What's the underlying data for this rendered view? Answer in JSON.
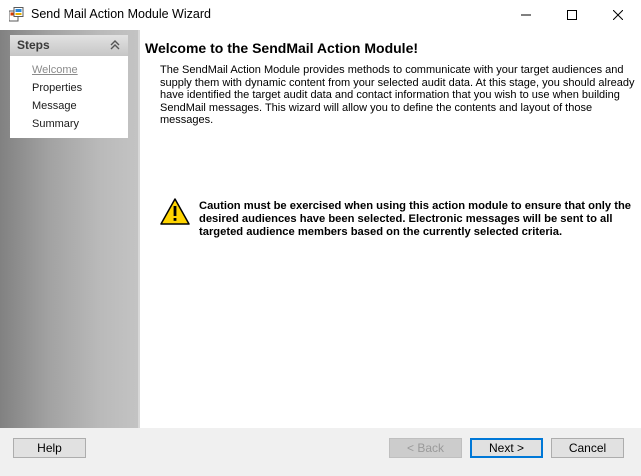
{
  "window": {
    "title": "Send Mail Action Module Wizard",
    "icon": "app-icon"
  },
  "sidebar": {
    "header": "Steps",
    "collapse_icon": "chevrons-up-icon",
    "items": [
      {
        "label": "Welcome",
        "active": true
      },
      {
        "label": "Properties",
        "active": false
      },
      {
        "label": "Message",
        "active": false
      },
      {
        "label": "Summary",
        "active": false
      }
    ]
  },
  "content": {
    "title": "Welcome to the SendMail Action Module!",
    "description": "The SendMail Action Module provides methods to communicate with your target audiences and supply them with dynamic content from your selected audit data. At this stage, you should already have identified the target audit data and contact information that you wish to use when building SendMail messages. This wizard will allow you to define the contents and layout of those messages.",
    "caution_icon": "warning-icon",
    "caution": "Caution must be exercised when using this action module to ensure that only the desired audiences have been selected. Electronic messages will be sent to all targeted audience members based on the currently selected criteria."
  },
  "footer": {
    "help": "Help",
    "back": "< Back",
    "next": "Next >",
    "cancel": "Cancel"
  },
  "colors": {
    "accent": "#0078d7",
    "warning_fill": "#ffd400"
  }
}
